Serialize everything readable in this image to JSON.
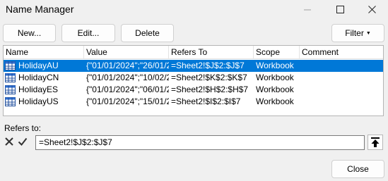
{
  "window": {
    "title": "Name Manager"
  },
  "toolbar": {
    "new_label": "New...",
    "edit_label": "Edit...",
    "delete_label": "Delete",
    "filter_label": "Filter"
  },
  "list": {
    "columns": [
      "Name",
      "Value",
      "Refers To",
      "Scope",
      "Comment"
    ],
    "rows": [
      {
        "name": "HolidayAU",
        "value": "{\"01/01/2024\";\"26/01/2...",
        "refers_to": "=Sheet2!$J$2:$J$7",
        "scope": "Workbook",
        "comment": "",
        "selected": true
      },
      {
        "name": "HolidayCN",
        "value": "{\"01/01/2024\";\"10/02/2...",
        "refers_to": "=Sheet2!$K$2:$K$7",
        "scope": "Workbook",
        "comment": "",
        "selected": false
      },
      {
        "name": "HolidayES",
        "value": "{\"01/01/2024\";\"06/01/2...",
        "refers_to": "=Sheet2!$H$2:$H$7",
        "scope": "Workbook",
        "comment": "",
        "selected": false
      },
      {
        "name": "HolidayUS",
        "value": "{\"01/01/2024\";\"15/01/2...",
        "refers_to": "=Sheet2!$I$2:$I$7",
        "scope": "Workbook",
        "comment": "",
        "selected": false
      }
    ]
  },
  "refers": {
    "label": "Refers to:",
    "value": "=Sheet2!$J$2:$J$7"
  },
  "footer": {
    "close_label": "Close"
  },
  "icons": {
    "row_icon": "named-range-icon",
    "cancel": "x-icon",
    "confirm": "check-icon",
    "collapse": "up-arrow-icon"
  },
  "colors": {
    "selection": "#0078d7",
    "background": "#f0f0f0"
  }
}
